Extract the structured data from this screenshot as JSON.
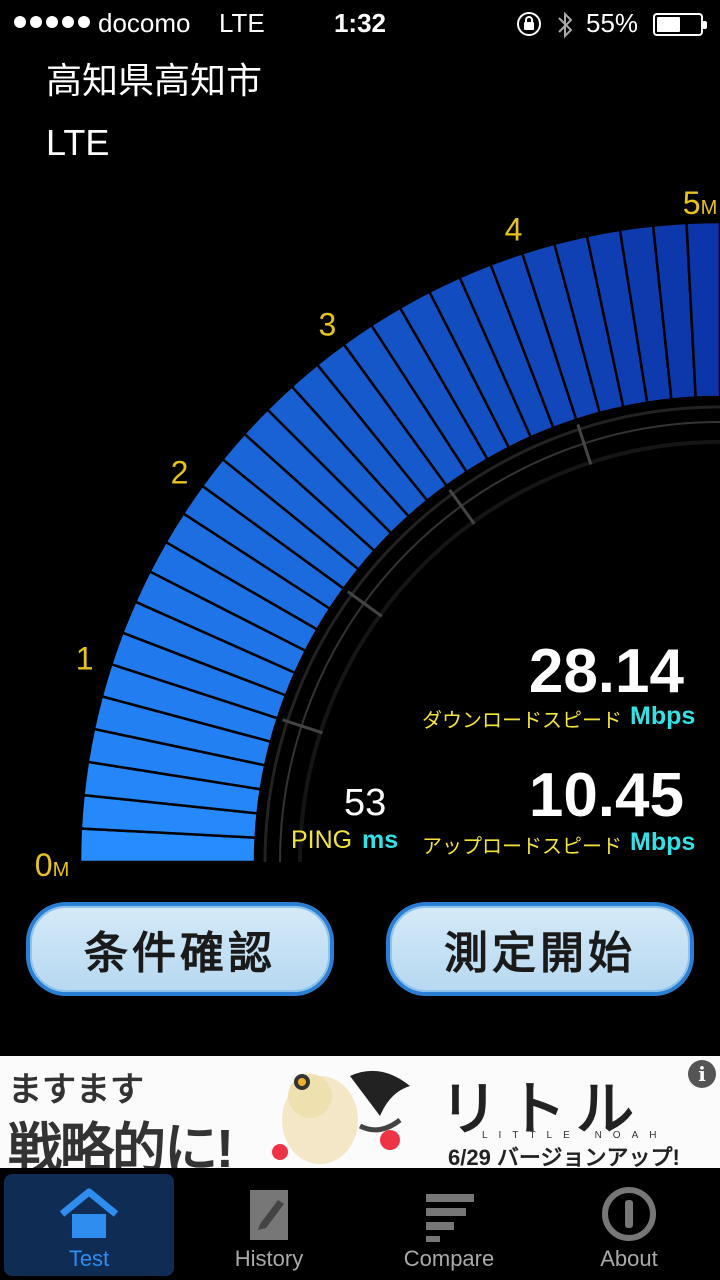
{
  "status_bar": {
    "carrier": "docomo",
    "network": "LTE",
    "time": "1:32",
    "battery_percent": "55%",
    "battery_level": 0.55
  },
  "location": {
    "area": "高知県高知市",
    "connection_type": "LTE"
  },
  "gauge": {
    "tick_labels": [
      "0M",
      "1",
      "2",
      "3",
      "4",
      "5M"
    ],
    "fill_level_mbps": 5,
    "max_mbps": 5
  },
  "results": {
    "download": {
      "value": "28.14",
      "caption": "ダウンロードスピード",
      "unit": "Mbps"
    },
    "upload": {
      "value": "10.45",
      "caption": "アップロードスピード",
      "unit": "Mbps"
    },
    "ping": {
      "value": "53",
      "label": "PING",
      "unit": "ms"
    }
  },
  "buttons": {
    "conditions": "条件確認",
    "start": "測定開始"
  },
  "ad": {
    "line1": "ますます",
    "line2": "戦略的に!",
    "brand": "リトル ノア",
    "brand_sub": "LITTLE NOAH",
    "version_note": "6/29 バージョンアップ!",
    "info_icon": "i"
  },
  "tabs": [
    {
      "label": "Test",
      "icon": "home-icon",
      "active": true
    },
    {
      "label": "History",
      "icon": "history-icon",
      "active": false
    },
    {
      "label": "Compare",
      "icon": "compare-icon",
      "active": false
    },
    {
      "label": "About",
      "icon": "info-icon",
      "active": false
    }
  ],
  "colors": {
    "accent_blue": "#2f8df0",
    "label_yellow": "#f3e43c",
    "unit_cyan": "#31e3e8",
    "gauge_tick_yellow": "#e7c31e"
  }
}
